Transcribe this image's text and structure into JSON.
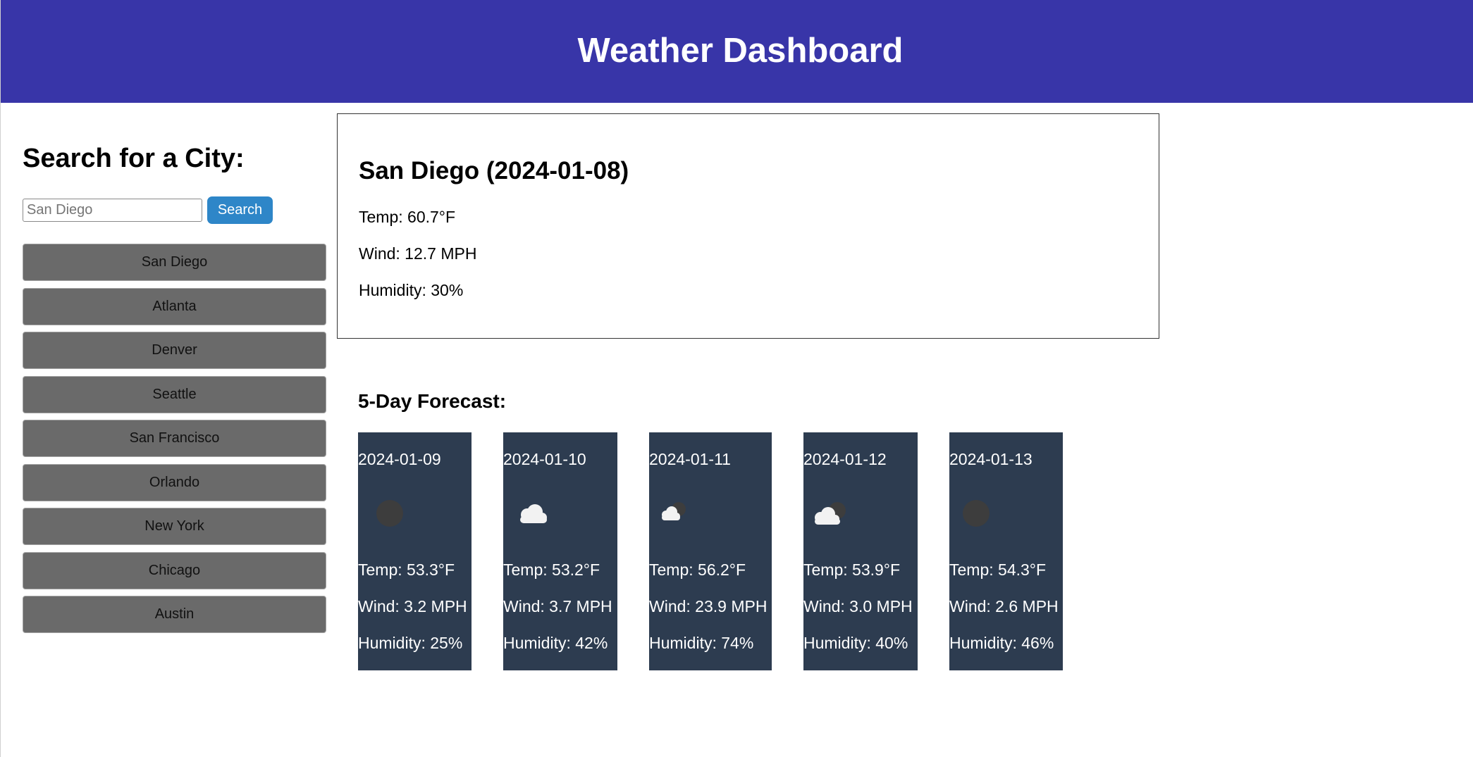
{
  "header": {
    "title": "Weather Dashboard"
  },
  "sidebar": {
    "heading": "Search for a City:",
    "search_placeholder": "San Diego",
    "search_button": "Search",
    "cities": [
      "San Diego",
      "Atlanta",
      "Denver",
      "Seattle",
      "San Francisco",
      "Orlando",
      "New York",
      "Chicago",
      "Austin"
    ]
  },
  "current": {
    "title": "San Diego (2024-01-08)",
    "temp": "Temp: 60.7°F",
    "wind": "Wind: 12.7 MPH",
    "humidity": "Humidity: 30%"
  },
  "forecast": {
    "title": "5-Day Forecast:",
    "days": [
      {
        "date": "2024-01-09",
        "icon": "clear-night-icon",
        "temp": "Temp: 53.3°F",
        "wind": "Wind: 3.2 MPH",
        "humidity": "Humidity: 25%"
      },
      {
        "date": "2024-01-10",
        "icon": "cloud-icon",
        "temp": "Temp: 53.2°F",
        "wind": "Wind: 3.7 MPH",
        "humidity": "Humidity: 42%"
      },
      {
        "date": "2024-01-11",
        "icon": "partly-cloudy-night-icon",
        "temp": "Temp: 56.2°F",
        "wind": "Wind: 23.9 MPH",
        "humidity": "Humidity: 74%"
      },
      {
        "date": "2024-01-12",
        "icon": "partly-cloudy-night-icon",
        "temp": "Temp: 53.9°F",
        "wind": "Wind: 3.0 MPH",
        "humidity": "Humidity: 40%"
      },
      {
        "date": "2024-01-13",
        "icon": "clear-night-icon",
        "temp": "Temp: 54.3°F",
        "wind": "Wind: 2.6 MPH",
        "humidity": "Humidity: 46%"
      }
    ]
  },
  "colors": {
    "header_bg": "#3835a8",
    "search_button_bg": "#2e86c8",
    "city_button_bg": "#6a6a6a",
    "forecast_card_bg": "#2d3c50"
  }
}
